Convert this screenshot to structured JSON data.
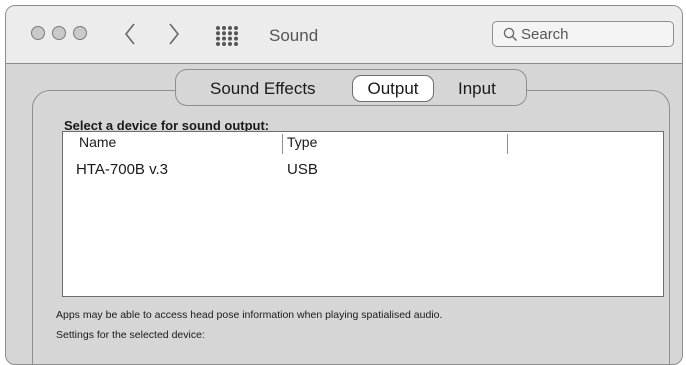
{
  "window": {
    "title": "Sound",
    "traffic_lights": [
      "close",
      "minimize",
      "zoom"
    ],
    "nav_back_icon": "chevron-left-icon",
    "nav_forward_icon": "chevron-right-icon",
    "grid_icon": "grid-icon"
  },
  "search": {
    "placeholder": "Search"
  },
  "tabs": [
    {
      "label": "Sound Effects",
      "selected": false
    },
    {
      "label": "Output",
      "selected": true
    },
    {
      "label": "Input",
      "selected": false
    }
  ],
  "output": {
    "section_label": "Select a device for sound output:",
    "columns": [
      "Name",
      "Type"
    ],
    "rows": [
      {
        "name": "HTA-700B v.3",
        "type": "USB"
      }
    ],
    "note": "Apps may be able to access head pose information when playing spatialised audio.",
    "settings_label": "Settings for the selected device:"
  }
}
